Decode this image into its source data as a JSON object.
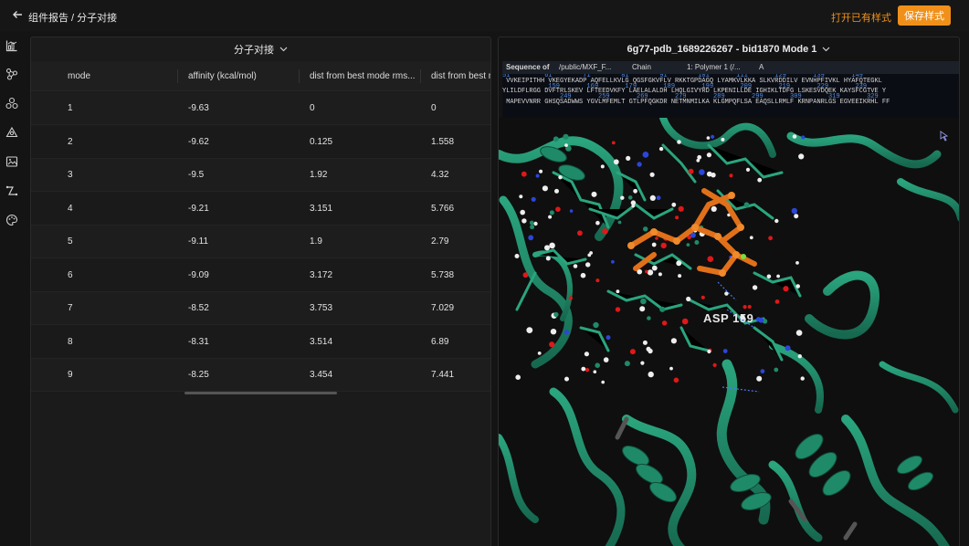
{
  "topbar": {
    "breadcrumb": "组件报告 / 分子对接",
    "open_style_label": "打开已有样式",
    "save_style_label": "保存样式"
  },
  "sidebar": {
    "items": [
      {
        "icon": "bar-chart-icon"
      },
      {
        "icon": "network-icon"
      },
      {
        "icon": "molecule-icon"
      },
      {
        "icon": "triangle-graph-icon"
      },
      {
        "icon": "image-icon"
      },
      {
        "icon": "path-icon"
      },
      {
        "icon": "palette-icon"
      }
    ]
  },
  "left_panel": {
    "title": "分子对接",
    "columns": [
      "mode",
      "affinity (kcal/mol)",
      "dist from best mode rms...",
      "dist from best m"
    ],
    "rows": [
      [
        "1",
        "-9.63",
        "0",
        "0"
      ],
      [
        "2",
        "-9.62",
        "0.125",
        "1.558"
      ],
      [
        "3",
        "-9.5",
        "1.92",
        "4.32"
      ],
      [
        "4",
        "-9.21",
        "3.151",
        "5.766"
      ],
      [
        "5",
        "-9.11",
        "1.9",
        "2.79"
      ],
      [
        "6",
        "-9.09",
        "3.172",
        "5.738"
      ],
      [
        "7",
        "-8.52",
        "3.753",
        "7.029"
      ],
      [
        "8",
        "-8.31",
        "3.514",
        "6.89"
      ],
      [
        "9",
        "-8.25",
        "3.454",
        "7.441"
      ]
    ]
  },
  "right_panel": {
    "title": "6g77-pdb_1689226267 - bid1870 Mode 1",
    "sequence_bar": {
      "label": "Sequence of",
      "path": "/public/MXF_F...",
      "chain_label": "Chain",
      "polymer": "1: Polymer 1 (/...",
      "chain_value": "A"
    },
    "sequence_lines": [
      {
        "nums": "51         61        71        81        91        101       111       129       139       149",
        "res": " VVKEIPITHH VKEGYEKADP AQFELLKVLG QGSFGKVFLV RKKTGPDAGQ LYAMKVLKKA SLKVRDDILV EVNHPFIVKL HYAFQTEGKL"
      },
      {
        "nums": "            159       169       179       189       199       209       219       229       239",
        "res": "YLILDFLRGG DVFTRLSKEV LFTEEDVKFY LAELALALDH LHQLGIVYRD LKPENILLDE IGHIKLTDFG LSKESVDQEK KAYSFCGTVE Y"
      },
      {
        "nums": "               249       259       269       279       289       299       309       319       329",
        "res": " MAPEVVNRR GHSQSADWWS YGVLMFEMLT GTLPFQGKDR NETMNMILKA KLGMPQFLSA EAQSLLRMLF KRNPANRLGS EGVEEIKRHL FF"
      }
    ],
    "residue_label": "ASP 159",
    "colors": {
      "protein": "#1f8a68",
      "ligand": "#e0701a",
      "nitrogen": "#2b46d8",
      "oxygen": "#e01818",
      "hydrogen": "#eeeeee"
    }
  }
}
